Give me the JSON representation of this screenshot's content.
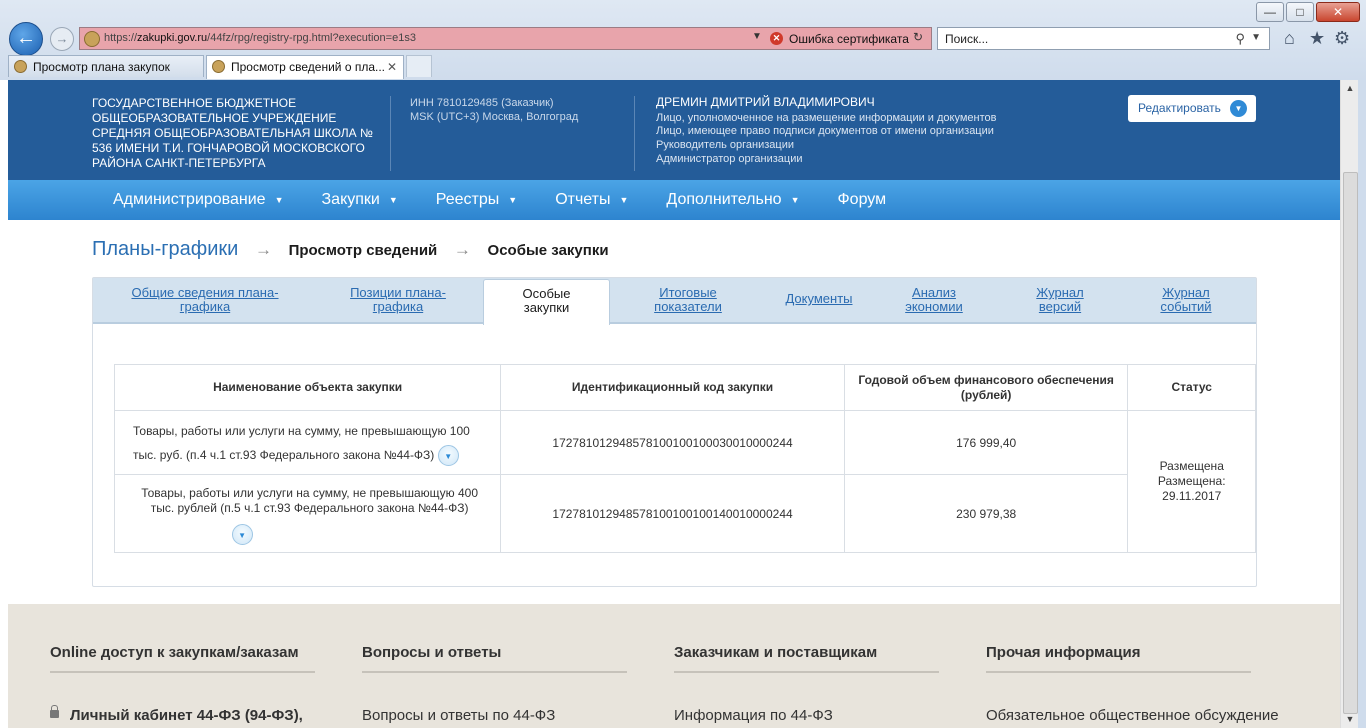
{
  "browser": {
    "url_prefix": "https://",
    "url_domain": "zakupki.gov.ru",
    "url_rest": "/44fz/rpg/registry-rpg.html?execution=e1s3",
    "cert_error": "Ошибка сертификата",
    "search_placeholder": "Поиск...",
    "window_controls": {
      "minimize": "—",
      "maximize": "□",
      "close": "✕"
    },
    "tabs": [
      {
        "label": "Просмотр плана закупок"
      },
      {
        "label": "Просмотр сведений о пла...",
        "close": "✕"
      }
    ]
  },
  "header": {
    "org_name": "ГОСУДАРСТВЕННОЕ БЮДЖЕТНОЕ ОБЩЕОБРАЗОВАТЕЛЬНОЕ УЧРЕЖДЕНИЕ СРЕДНЯЯ ОБЩЕОБРАЗОВАТЕЛЬНАЯ ШКОЛА № 536 ИМЕНИ Т.И. ГОНЧАРОВОЙ МОСКОВСКОГО РАЙОНА САНКТ-ПЕТЕРБУРГА",
    "inn": "ИНН 7810129485 (Заказчик)",
    "timezone": "MSK (UTC+3) Москва, Волгоград",
    "user_name": "ДРЕМИН ДМИТРИЙ ВЛАДИМИРОВИЧ",
    "roles": [
      "Лицо, уполномоченное на размещение информации и документов",
      "Лицо, имеющее право подписи документов от имени организации",
      "Руководитель организации",
      "Администратор организации"
    ],
    "edit_button": "Редактировать"
  },
  "menu": [
    {
      "label": "Администрирование",
      "caret": true
    },
    {
      "label": "Закупки",
      "caret": true
    },
    {
      "label": "Реестры",
      "caret": true
    },
    {
      "label": "Отчеты",
      "caret": true
    },
    {
      "label": "Дополнительно",
      "caret": true
    },
    {
      "label": "Форум",
      "caret": false
    }
  ],
  "breadcrumb": {
    "root": "Планы-графики",
    "items": [
      "Просмотр сведений",
      "Особые закупки"
    ]
  },
  "panel_tabs": [
    {
      "line1": "Общие сведения плана-",
      "line2": "графика"
    },
    {
      "line1": "Позиции плана-",
      "line2": "графика"
    },
    {
      "line1": "Особые",
      "line2": "закупки"
    },
    {
      "line1": "Итоговые",
      "line2": "показатели"
    },
    {
      "line1": "Документы",
      "line2": ""
    },
    {
      "line1": "Анализ",
      "line2": "экономии"
    },
    {
      "line1": "Журнал",
      "line2": "версий"
    },
    {
      "line1": "Журнал",
      "line2": "событий"
    }
  ],
  "table": {
    "headers": [
      "Наименование объекта закупки",
      "Идентификационный код закупки",
      "Годовой объем финансового обеспечения (рублей)",
      "Статус"
    ],
    "rows": [
      {
        "name": "Товары, работы или услуги на сумму, не превышающую 100 тыс. руб. (п.4 ч.1 ст.93 Федерального закона №44-ФЗ)",
        "code": "172781012948578100100100030010000244",
        "amount": "176 999,40"
      },
      {
        "name": "Товары, работы или услуги на сумму, не превышающую 400 тыс. рублей (п.5 ч.1 ст.93 Федерального закона №44-ФЗ)",
        "code": "172781012948578100100100140010000244",
        "amount": "230 979,38"
      }
    ],
    "status_line1": "Размещена",
    "status_line2": "Размещена:",
    "status_date": "29.11.2017"
  },
  "footer": {
    "columns": [
      {
        "heading": "Online доступ к закупкам/заказам",
        "link": "Личный кабинет 44-ФЗ (94-ФЗ),"
      },
      {
        "heading": "Вопросы и ответы",
        "link": "Вопросы и ответы по 44-ФЗ"
      },
      {
        "heading": "Заказчикам и поставщикам",
        "link": "Информация по 44-ФЗ"
      },
      {
        "heading": "Прочая информация",
        "link": "Обязательное общественное обсуждение"
      }
    ]
  },
  "colors": {
    "header_bg": "#245c99",
    "menu_bg": "#2d84cf",
    "link": "#2b6fb3",
    "address_bar_error": "#e8a4ab",
    "footer_bg": "#e8e4dc"
  }
}
